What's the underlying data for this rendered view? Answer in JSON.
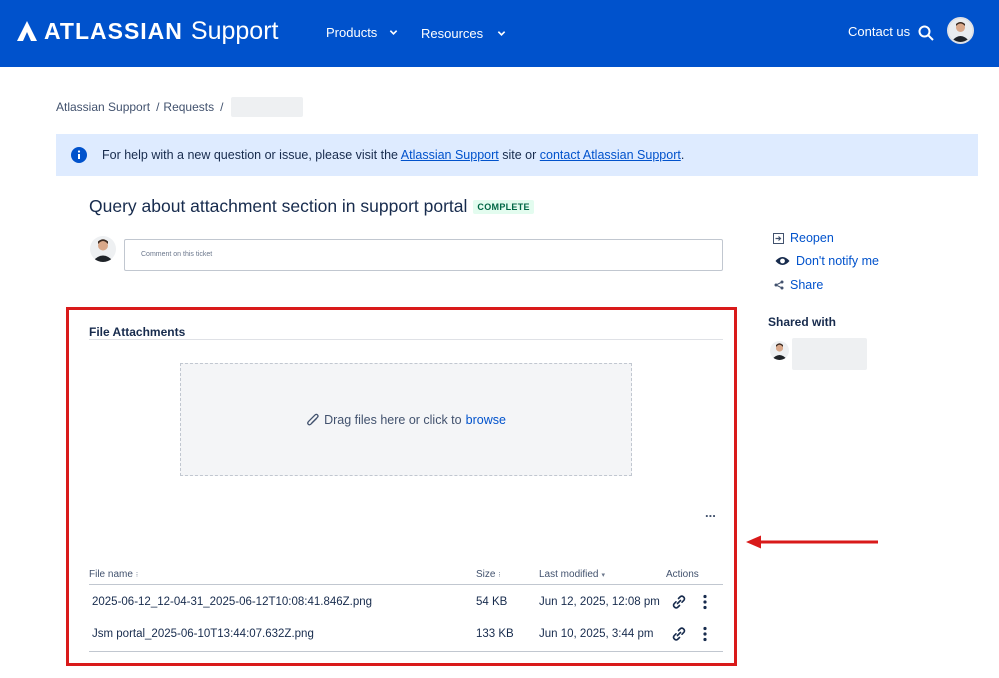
{
  "header": {
    "brand": "ATLASSIAN",
    "product": "Support",
    "nav": [
      {
        "label": "Products"
      },
      {
        "label": "Resources"
      }
    ],
    "contact_label": "Contact us"
  },
  "breadcrumb": {
    "items": [
      "Atlassian Support",
      "Requests"
    ],
    "separator": "/"
  },
  "banner": {
    "text_before": "For help with a new question or issue, please visit the ",
    "link1": "Atlassian Support",
    "text_middle": " site or ",
    "link2": "contact Atlassian Support",
    "text_after": "."
  },
  "ticket": {
    "title": "Query about attachment section in support portal",
    "status": "COMPLETE",
    "comment_placeholder": "Comment on this ticket"
  },
  "sidebar": {
    "actions": [
      {
        "label": "Reopen",
        "icon": "reopen-icon"
      },
      {
        "label": "Don't notify me",
        "icon": "eye-icon"
      },
      {
        "label": "Share",
        "icon": "share-icon"
      }
    ],
    "shared_with_label": "Shared with"
  },
  "attachments": {
    "title": "File Attachments",
    "dropzone_text": "Drag files here or click to",
    "dropzone_link": "browse",
    "more_label": "...",
    "columns": {
      "name": "File name",
      "size": "Size",
      "modified": "Last modified",
      "actions": "Actions"
    },
    "rows": [
      {
        "name": "2025-06-12_12-04-31_2025-06-12T10:08:41.846Z.png",
        "size": "54 KB",
        "modified": "Jun 12, 2025, 12:08 pm"
      },
      {
        "name": "Jsm portal_2025-06-10T13:44:07.632Z.png",
        "size": "133 KB",
        "modified": "Jun 10, 2025, 3:44 pm"
      }
    ]
  },
  "colors": {
    "header_bg": "#0052cc",
    "banner_bg": "#deebff",
    "link": "#0052cc",
    "highlight": "#d91a1a",
    "status_text": "#006644",
    "status_bg": "#e3fcef"
  }
}
